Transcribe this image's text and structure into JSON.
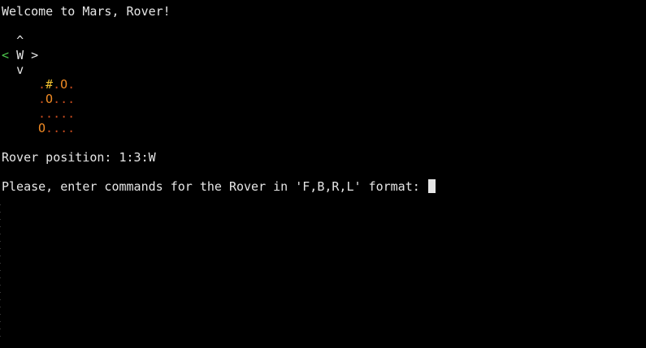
{
  "terminal": {
    "welcome": "Welcome to Mars, Rover!",
    "compass": {
      "up": "^",
      "left": "<",
      "heading": "W",
      "right": ">",
      "down": "v",
      "active_color": "#4ec94e"
    },
    "map": {
      "rows": [
        [
          ".",
          "#",
          ".",
          "O",
          "."
        ],
        [
          ".",
          "O",
          ".",
          ".",
          "."
        ],
        [
          ".",
          ".",
          ".",
          ".",
          "."
        ],
        [
          "O",
          ".",
          ".",
          ".",
          "."
        ]
      ],
      "colors": {
        "dot": "#c24a1e",
        "obstacle": "#f08a24",
        "rover": "#f2c230"
      }
    },
    "position_line": "Rover position: 1:3:W",
    "prompt": "Please, enter commands for the Rover in 'F,B,R,L' format: "
  }
}
